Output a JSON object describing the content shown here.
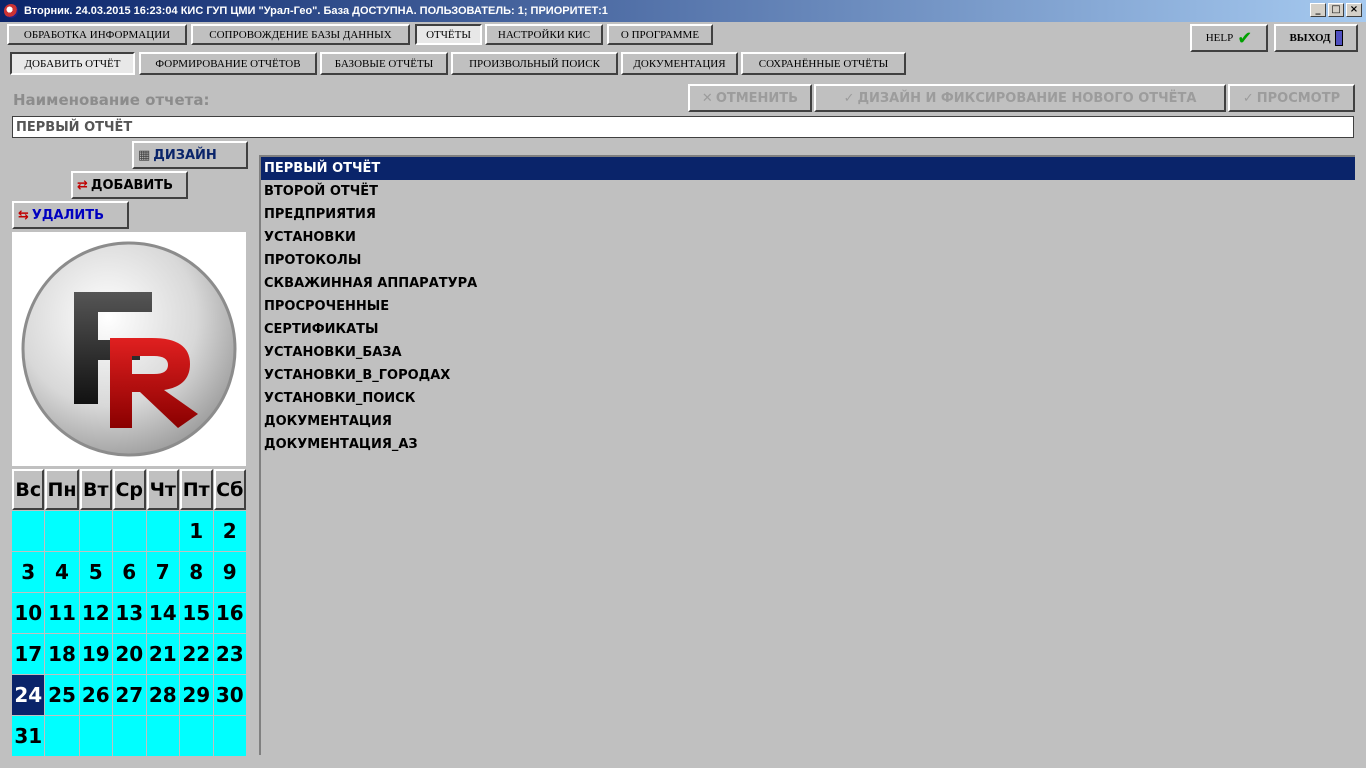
{
  "window": {
    "title": "Вторник. 24.03.2015 16:23:04 КИС ГУП ЦМИ \"Урал-Гео\". База ДОСТУПНА. ПОЛЬЗОВАТЕЛЬ: 1; ПРИОРИТЕТ:1",
    "controls": {
      "minimize": "_",
      "maximize": "□",
      "close": "×"
    }
  },
  "main_tabs": [
    {
      "label": "ОБРАБОТКА ИНФОРМАЦИИ"
    },
    {
      "label": "СОПРОВОЖДЕНИЕ БАЗЫ ДАННЫХ"
    },
    {
      "label": "ОТЧЁТЫ"
    },
    {
      "label": "НАСТРОЙКИ КИС"
    },
    {
      "label": "О ПРОГРАММЕ"
    }
  ],
  "top_right": {
    "help_label": "HELP",
    "exit_label": "ВЫХОД"
  },
  "sub_tabs": [
    {
      "label": "ДОБАВИТЬ ОТЧЁТ"
    },
    {
      "label": "ФОРМИРОВАНИЕ ОТЧЁТОВ"
    },
    {
      "label": "БАЗОВЫЕ ОТЧЁТЫ"
    },
    {
      "label": "ПРОИЗВОЛЬНЫЙ ПОИСК"
    },
    {
      "label": "ДОКУМЕНТАЦИЯ"
    },
    {
      "label": "СОХРАНЁННЫЕ ОТЧЁТЫ"
    }
  ],
  "form": {
    "name_label": "Наименование отчета:",
    "name_value": "ПЕРВЫЙ ОТЧЁТ",
    "cancel_label": "ОТМЕНИТЬ",
    "design_fix_label": "ДИЗАЙН И ФИКСИРОВАНИЕ НОВОГО ОТЧЁТА",
    "preview_label": "ПРОСМОТР"
  },
  "side_actions": {
    "design_label": "ДИЗАЙН",
    "add_label": "ДОБАВИТЬ",
    "delete_label": "УДАЛИТЬ"
  },
  "reports": [
    "ПЕРВЫЙ ОТЧЁТ",
    "ВТОРОЙ ОТЧЁТ",
    "ПРЕДПРИЯТИЯ",
    "УСТАНОВКИ",
    "ПРОТОКОЛЫ",
    "СКВАЖИННАЯ АППАРАТУРА",
    "ПРОСРОЧЕННЫЕ",
    "СЕРТИФИКАТЫ",
    "УСТАНОВКИ_БАЗА",
    "УСТАНОВКИ_В_ГОРОДАХ",
    "УСТАНОВКИ_ПОИСК",
    "ДОКУМЕНТАЦИЯ",
    "ДОКУМЕНТАЦИЯ_АЗ"
  ],
  "calendar": {
    "weekdays": [
      "Вс",
      "Пн",
      "Вт",
      "Ср",
      "Чт",
      "Пт",
      "Сб"
    ],
    "days": [
      "",
      "",
      "",
      "",
      "",
      "1",
      "2",
      "3",
      "4",
      "5",
      "6",
      "7",
      "8",
      "9",
      "10",
      "11",
      "12",
      "13",
      "14",
      "15",
      "16",
      "17",
      "18",
      "19",
      "20",
      "21",
      "22",
      "23",
      "24",
      "25",
      "26",
      "27",
      "28",
      "29",
      "30",
      "31",
      "",
      "",
      "",
      "",
      "",
      ""
    ],
    "selected_day": "24"
  },
  "colors": {
    "selection": "#0a246a",
    "calendar_bg": "#00ffff",
    "face": "#c0c0c0"
  }
}
